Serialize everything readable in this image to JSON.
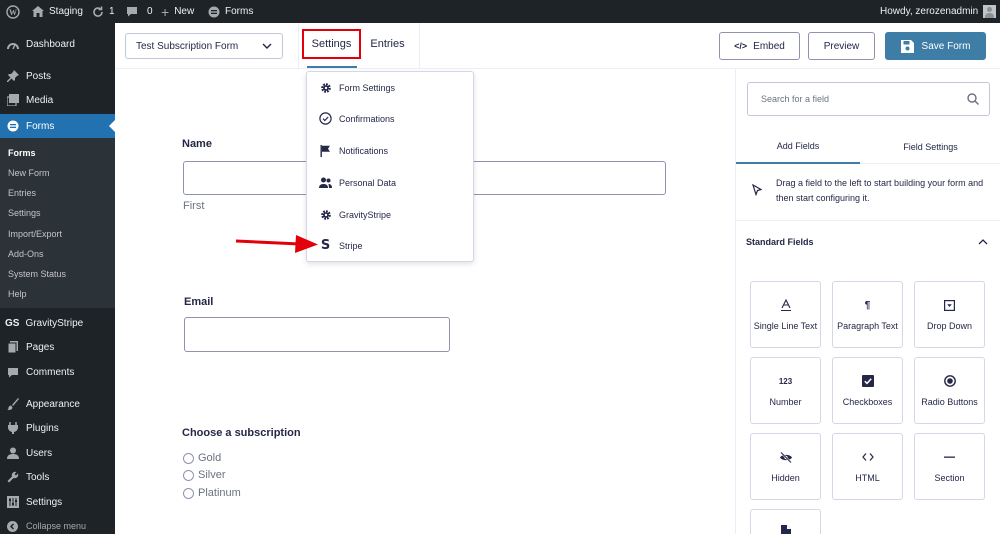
{
  "admin_bar": {
    "site_name": "Staging",
    "updates_count": "1",
    "comments_count": "0",
    "new_label": "New",
    "forms_label": "Forms",
    "howdy": "Howdy, zerozenadmin"
  },
  "sidebar": {
    "dashboard": "Dashboard",
    "posts": "Posts",
    "media": "Media",
    "forms": "Forms",
    "submenu": [
      "Forms",
      "New Form",
      "Entries",
      "Settings",
      "Import/Export",
      "Add-Ons",
      "System Status",
      "Help"
    ],
    "gravitystripe_badge": "GS",
    "gravitystripe": "GravityStripe",
    "pages": "Pages",
    "comments": "Comments",
    "appearance": "Appearance",
    "plugins": "Plugins",
    "users": "Users",
    "tools": "Tools",
    "settings": "Settings",
    "collapse": "Collapse menu"
  },
  "toolbar": {
    "form_select": "Test Subscription Form",
    "tab_settings": "Settings",
    "tab_entries": "Entries",
    "embed": "Embed",
    "embed_glyph": "</>",
    "preview": "Preview",
    "save": "Save Form"
  },
  "settings_menu": {
    "items": [
      "Form Settings",
      "Confirmations",
      "Notifications",
      "Personal Data",
      "GravityStripe",
      "Stripe"
    ]
  },
  "form": {
    "name_label": "Name",
    "name_sublabel": "First",
    "email_label": "Email",
    "subscription_label": "Choose a subscription",
    "options": [
      "Gold",
      "Silver",
      "Platinum"
    ]
  },
  "right_panel": {
    "search_placeholder": "Search for a field",
    "tab_add_fields": "Add Fields",
    "tab_field_settings": "Field Settings",
    "hint": "Drag a field to the left to start building your form and then start configuring it.",
    "standard_fields": "Standard Fields",
    "number_glyph": "123",
    "paragraph_glyph": "¶",
    "fields": [
      "Single Line Text",
      "Paragraph Text",
      "Drop Down",
      "Number",
      "Checkboxes",
      "Radio Buttons",
      "Hidden",
      "HTML",
      "Section"
    ]
  },
  "colors": {
    "admin_bg": "#1d2327",
    "active_menu": "#2271b1",
    "accent": "#3e7da6",
    "annotation_red": "#e3000b"
  }
}
